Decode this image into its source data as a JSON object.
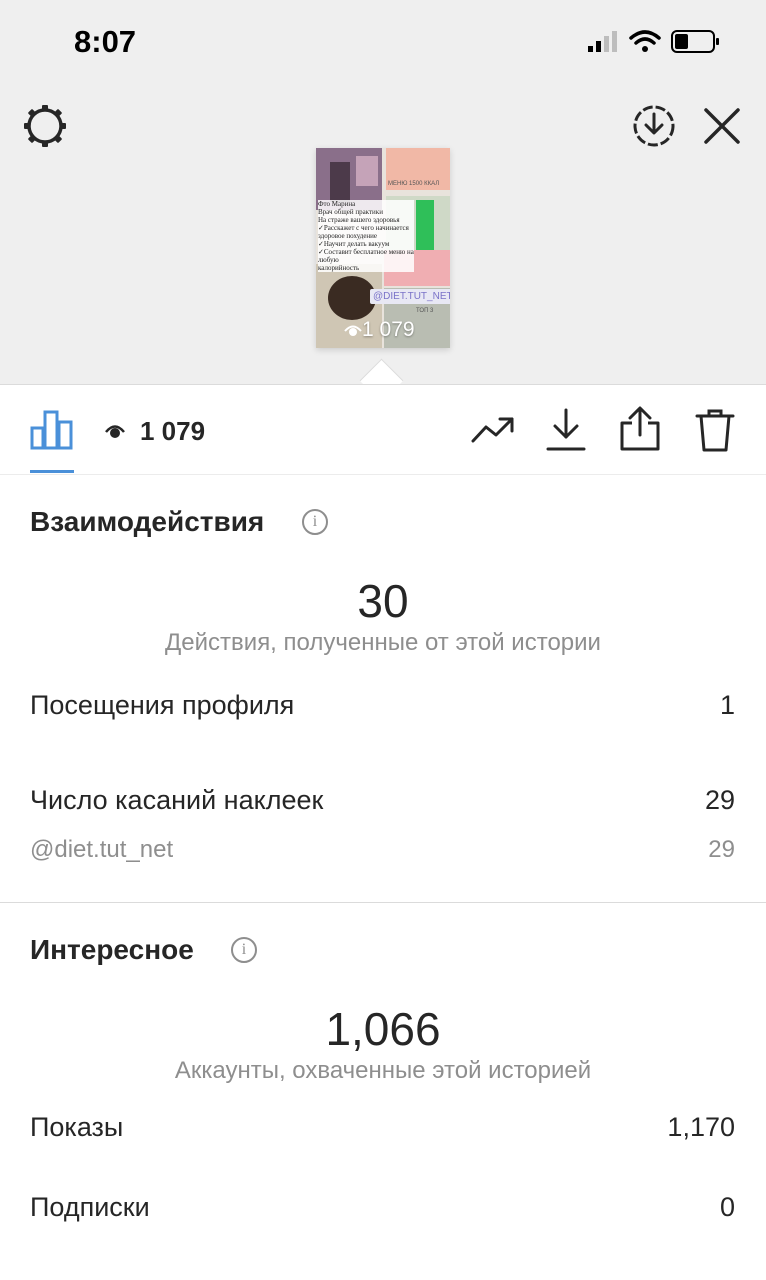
{
  "status_bar": {
    "time": "8:07"
  },
  "story_preview": {
    "views_overlay": "1 079",
    "text_menu": "МЕНЮ 1500 ККАЛ",
    "text_lines": [
      "Фто Марина",
      "Врач общей практики",
      "На страже вашего здоровья",
      "✓Расскажет с чего начинается",
      "здоровое похудение",
      "✓Научит делать вакуум",
      "✓Составит бесплатное меню на любую",
      "калорийность"
    ],
    "sticker_handle": "@DIET.TUT_NET",
    "text_top": "ТОП 3"
  },
  "toolbar": {
    "views_count": "1 079"
  },
  "interactions": {
    "title": "Взаимодействия",
    "total": "30",
    "caption": "Действия, полученные от этой истории",
    "rows": [
      {
        "label": "Посещения профиля",
        "value": "1"
      },
      {
        "label": "Число касаний наклеек",
        "value": "29"
      }
    ],
    "sub_row": {
      "label": "@diet.tut_net",
      "value": "29"
    }
  },
  "discovery": {
    "title": "Интересное",
    "total": "1,066",
    "caption": "Аккаунты, охваченные этой историей",
    "rows": [
      {
        "label": "Показы",
        "value": "1,170"
      },
      {
        "label": "Подписки",
        "value": "0"
      }
    ]
  },
  "colors": {
    "accent": "#4a90d9",
    "text": "#262626",
    "secondary": "#8e8e8e",
    "header_bg": "#efefef"
  },
  "icons": [
    "settings-icon",
    "download-circle-icon",
    "close-icon",
    "insights-bar-chart-icon",
    "eye-icon",
    "trend-icon",
    "save-download-icon",
    "share-icon",
    "trash-icon",
    "info-icon"
  ]
}
